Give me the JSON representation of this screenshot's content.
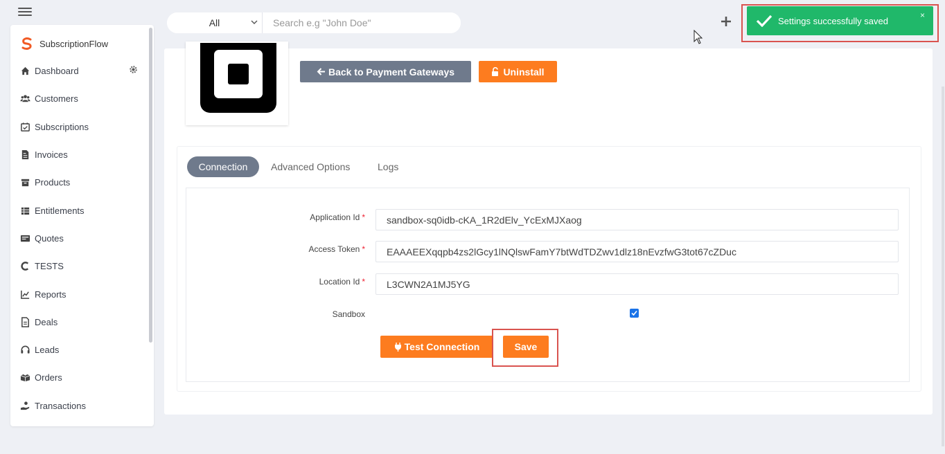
{
  "header": {
    "search_scope": "All",
    "search_placeholder": "Search e.g \"John Doe\""
  },
  "toast": {
    "message": "Settings successfully saved",
    "close": "×",
    "color": "#20b86a"
  },
  "sidebar": {
    "brand": "SubscriptionFlow",
    "items": [
      {
        "label": "Dashboard",
        "icon": "home-icon"
      },
      {
        "label": "Customers",
        "icon": "users-icon"
      },
      {
        "label": "Subscriptions",
        "icon": "calendar-check-icon"
      },
      {
        "label": "Invoices",
        "icon": "file-invoice-icon"
      },
      {
        "label": "Products",
        "icon": "box-icon"
      },
      {
        "label": "Entitlements",
        "icon": "layers-icon"
      },
      {
        "label": "Quotes",
        "icon": "quote-card-icon"
      },
      {
        "label": "TESTS",
        "icon": "c-icon"
      },
      {
        "label": "Reports",
        "icon": "chart-line-icon"
      },
      {
        "label": "Deals",
        "icon": "document-icon"
      },
      {
        "label": "Leads",
        "icon": "headset-icon"
      },
      {
        "label": "Orders",
        "icon": "boxes-icon"
      },
      {
        "label": "Transactions",
        "icon": "hand-coin-icon"
      }
    ]
  },
  "actions": {
    "back_label": "Back to Payment Gateways",
    "uninstall_label": "Uninstall"
  },
  "tabs": [
    {
      "label": "Connection",
      "active": true
    },
    {
      "label": "Advanced Options",
      "active": false
    },
    {
      "label": "Logs",
      "active": false
    }
  ],
  "form": {
    "application_id_label": "Application Id",
    "application_id_value": "sandbox-sq0idb-cKA_1R2dElv_YcExMJXaog",
    "access_token_label": "Access Token",
    "access_token_value": "EAAAEEXqqpb4zs2lGcy1lNQlswFamY7btWdTDZwv1dlz18nEvzfwG3tot67cZDuc",
    "location_id_label": "Location Id",
    "location_id_value": "L3CWN2A1MJ5YG",
    "sandbox_label": "Sandbox",
    "sandbox_checked": true,
    "required_mark": "*",
    "test_connection_label": "Test Connection",
    "save_label": "Save"
  },
  "colors": {
    "accent_orange": "#fd7c1f",
    "secondary_gray": "#6f7a8c",
    "highlight_red": "#d9534f"
  }
}
